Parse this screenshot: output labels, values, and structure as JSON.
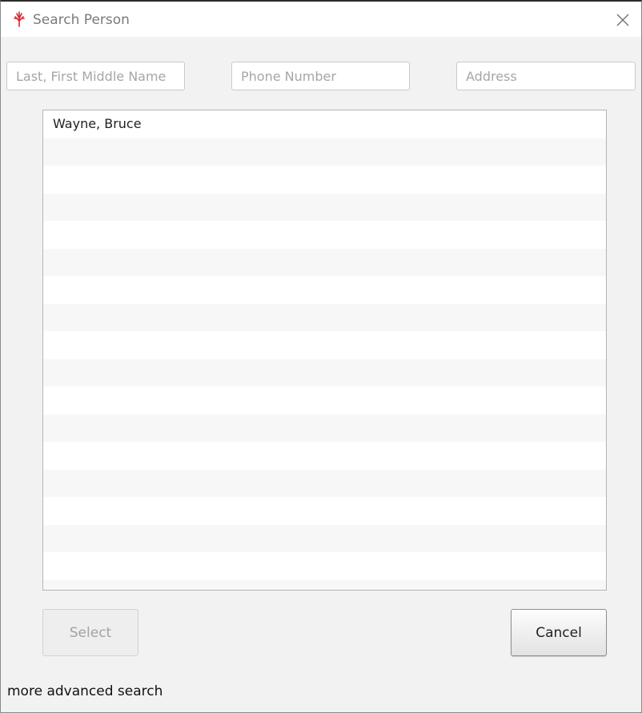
{
  "window": {
    "title": "Search Person",
    "accent_color": "#d9262b"
  },
  "search": {
    "name_placeholder": "Last, First Middle Name",
    "phone_placeholder": "Phone Number",
    "address_placeholder": "Address",
    "name_value": "",
    "phone_value": "",
    "address_value": ""
  },
  "results": {
    "items": [
      "Wayne, Bruce"
    ]
  },
  "buttons": {
    "select_label": "Select",
    "cancel_label": "Cancel"
  },
  "footer": {
    "advanced_link": "more advanced search"
  }
}
